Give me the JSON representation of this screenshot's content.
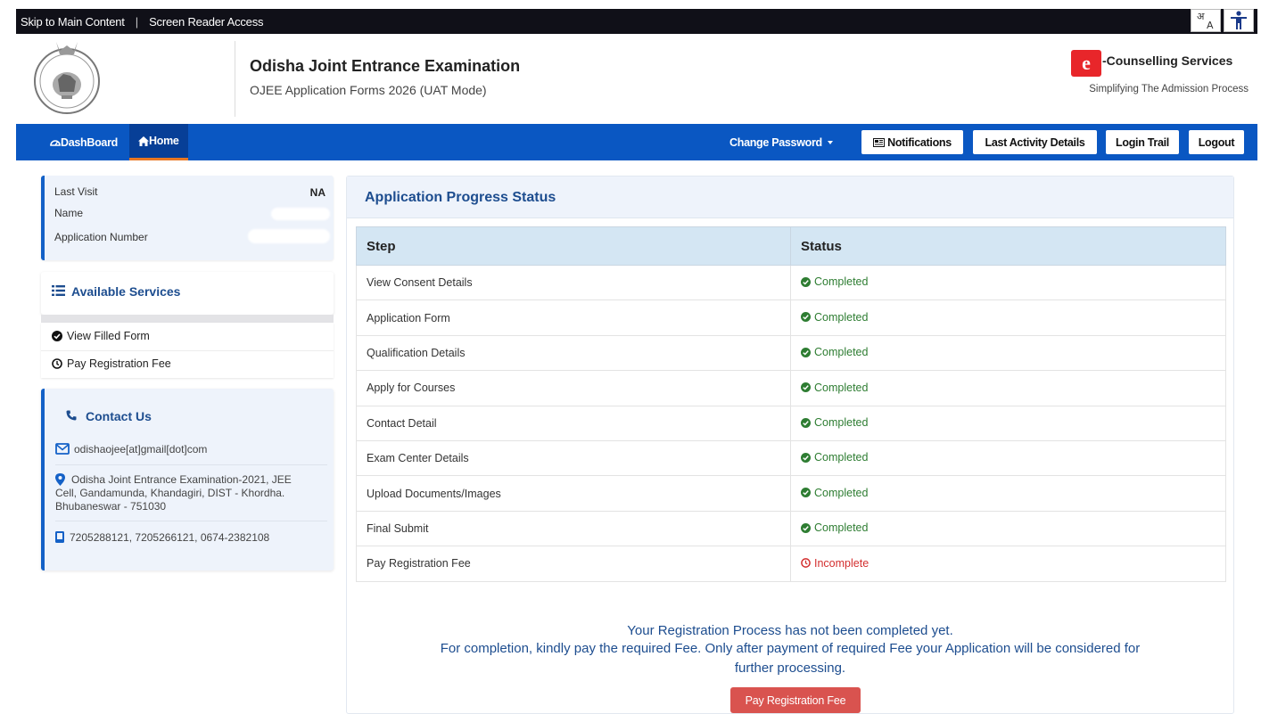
{
  "topbar": {
    "skip_link": "Skip to Main Content",
    "divider": "|",
    "screen_reader": "Screen Reader Access",
    "language_icon": "hindi-a-language-icon",
    "accessibility_icon": "accessibility-person-icon"
  },
  "header": {
    "emblem": "odisha-state-emblem",
    "title": "Odisha Joint Entrance Examination",
    "subtitle": "OJEE Application Forms 2026 (UAT Mode)",
    "brand_logo": "e-logo",
    "brand_title": "-Counselling Services",
    "brand_tagline": "Simplifying The Admission Process"
  },
  "nav": {
    "dashboard": "DashBoard",
    "home": "Home",
    "change_password": "Change Password",
    "notifications": "Notifications",
    "last_activity": "Last Activity Details",
    "login_trail": "Login Trail",
    "logout": "Logout"
  },
  "visit": {
    "last_visit_label": "Last Visit",
    "last_visit_value": "NA",
    "name_label": "Name",
    "app_number_label": "Application Number"
  },
  "services": {
    "title": "Available Services",
    "items": [
      {
        "label": "View Filled Form",
        "icon": "check-circle-icon"
      },
      {
        "label": "Pay Registration Fee",
        "icon": "clock-icon"
      }
    ]
  },
  "contact": {
    "title": "Contact Us",
    "email": "odishaojee[at]gmail[dot]com",
    "address_line1": "Odisha Joint Entrance Examination-2021, JEE",
    "address_line2": "Cell, Gandamunda, Khandagiri, DIST - Khordha.",
    "address_line3": "Bhubaneswar - 751030",
    "phones": "7205288121, 7205266121, 0674-2382108"
  },
  "progress": {
    "title": "Application Progress Status",
    "col_step": "Step",
    "col_status": "Status",
    "rows": [
      {
        "step": "View Consent Details",
        "status": "Completed"
      },
      {
        "step": "Application Form",
        "status": "Completed"
      },
      {
        "step": "Qualification Details",
        "status": "Completed"
      },
      {
        "step": "Apply for Courses",
        "status": "Completed"
      },
      {
        "step": "Contact Detail",
        "status": "Completed"
      },
      {
        "step": "Exam Center Details",
        "status": "Completed"
      },
      {
        "step": "Upload Documents/Images",
        "status": "Completed"
      },
      {
        "step": "Final Submit",
        "status": "Completed"
      },
      {
        "step": "Pay Registration Fee",
        "status": "Incomplete"
      }
    ],
    "message_line1": "Your Registration Process has not been completed yet.",
    "message_line2": "For completion, kindly pay the required Fee. Only after payment of required Fee your Application will be considered for",
    "message_line3": "further processing.",
    "pay_button": "Pay Registration Fee"
  },
  "colors": {
    "nav_blue": "#0a57c2",
    "heading_blue": "#1d4d8f",
    "completed_green": "#2e7d32",
    "incomplete_red": "#d32f2f",
    "pay_button_red": "#d9534f"
  }
}
